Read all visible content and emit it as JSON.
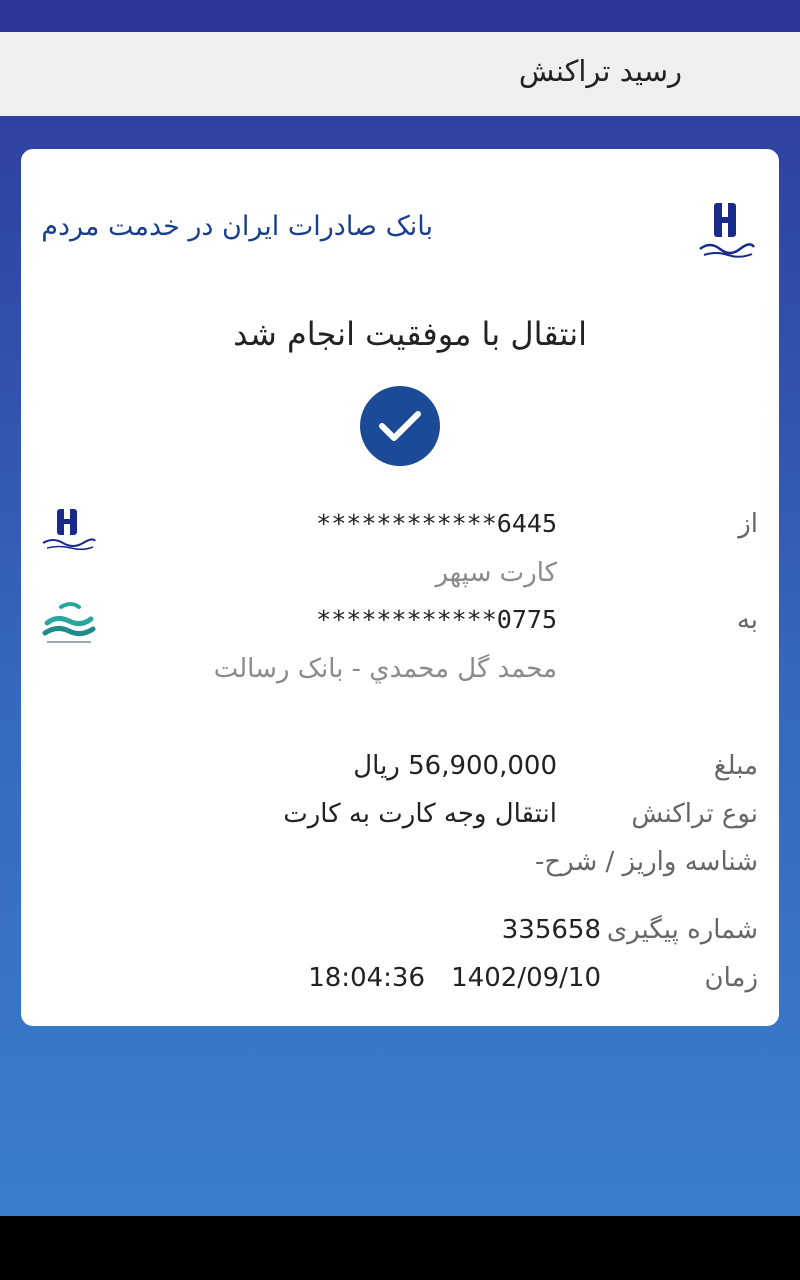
{
  "header": {
    "title": "رسید تراکنش"
  },
  "card": {
    "tagline": "بانک صادرات ایران در خدمت مردم",
    "success_message": "انتقال با موفقیت انجام شد",
    "from": {
      "label": "از",
      "card_number": "************6445",
      "card_name": "کارت سپهر",
      "bank_logo": "bank-saderat-logo"
    },
    "to": {
      "label": "به",
      "card_number": "************0775",
      "owner": "محمد گل  محمدي - بانک رسالت",
      "bank_logo": "bank-resalat-logo"
    },
    "amount": {
      "label": "مبلغ",
      "value": "56,900,000",
      "unit": "ریال"
    },
    "transaction_type": {
      "label": "نوع تراکنش",
      "value": "انتقال وجه کارت به کارت"
    },
    "payment_id": {
      "label": "شناسه واریز / شرح",
      "value": "-"
    },
    "tracking": {
      "label": "شماره پیگیری",
      "value": "335658"
    },
    "time": {
      "label": "زمان",
      "date": "1402/09/10",
      "clock": "18:04:36"
    }
  },
  "colors": {
    "primary": "#1b4a96",
    "header_bg": "#efefef",
    "gradient_top": "#303b9a",
    "gradient_bottom": "#3a80d0"
  }
}
